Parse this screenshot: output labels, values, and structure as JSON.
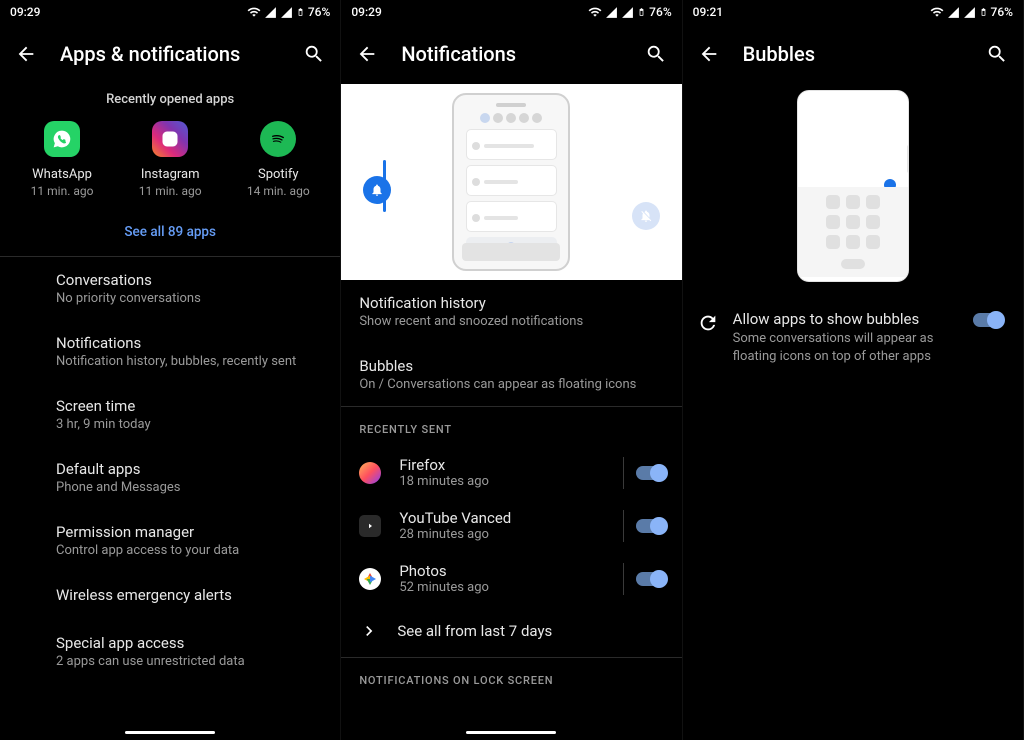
{
  "status": {
    "time1": "09:29",
    "time3": "09:21",
    "battery": "76%"
  },
  "screen1": {
    "title": "Apps & notifications",
    "section_header": "Recently opened apps",
    "apps": [
      {
        "name": "WhatsApp",
        "time": "11 min. ago"
      },
      {
        "name": "Instagram",
        "time": "11 min. ago"
      },
      {
        "name": "Spotify",
        "time": "14 min. ago"
      }
    ],
    "see_all": "See all 89 apps",
    "items": [
      {
        "primary": "Conversations",
        "secondary": "No priority conversations"
      },
      {
        "primary": "Notifications",
        "secondary": "Notification history, bubbles, recently sent"
      },
      {
        "primary": "Screen time",
        "secondary": "3 hr, 9 min today"
      },
      {
        "primary": "Default apps",
        "secondary": "Phone and Messages"
      },
      {
        "primary": "Permission manager",
        "secondary": "Control app access to your data"
      },
      {
        "primary": "Wireless emergency alerts",
        "secondary": ""
      },
      {
        "primary": "Special app access",
        "secondary": "2 apps can use unrestricted data"
      }
    ]
  },
  "screen2": {
    "title": "Notifications",
    "items_top": [
      {
        "primary": "Notification history",
        "secondary": "Show recent and snoozed notifications"
      },
      {
        "primary": "Bubbles",
        "secondary": "On / Conversations can appear as floating icons"
      }
    ],
    "subheader1": "RECENTLY SENT",
    "recent": [
      {
        "name": "Firefox",
        "sub": "18 minutes ago"
      },
      {
        "name": "YouTube Vanced",
        "sub": "28 minutes ago"
      },
      {
        "name": "Photos",
        "sub": "52 minutes ago"
      }
    ],
    "see_all": "See all from last 7 days",
    "subheader2": "NOTIFICATIONS ON LOCK SCREEN"
  },
  "screen3": {
    "title": "Bubbles",
    "item": {
      "primary": "Allow apps to show bubbles",
      "secondary": "Some conversations will appear as floating icons on top of other apps"
    }
  }
}
